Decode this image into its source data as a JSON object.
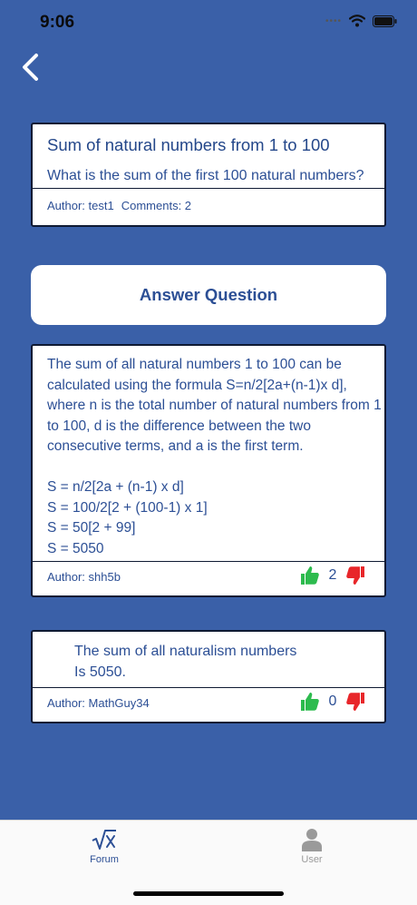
{
  "status_bar": {
    "time": "9:06"
  },
  "question": {
    "title": "Sum of natural numbers from 1 to 100",
    "body": "What is the sum of the first 100 natural numbers?",
    "author": "Author: test1",
    "comments": "Comments: 2"
  },
  "answer_button": {
    "label": "Answer Question"
  },
  "answers": [
    {
      "text": "The sum of all natural numbers 1 to 100 can be calculated using the formula S=n/2[2a+(n-1)x d], where n is the total number of natural numbers from 1 to 100, d is the difference between the two consecutive terms, and a is the first term.\n\nS = n/2[2a + (n-1) x d]\nS = 100/2[2 + (100-1) x 1]\nS = 50[2 + 99]\nS = 5050",
      "author": "Author: shh5b",
      "votes": "2"
    },
    {
      "text": "The sum of all naturalism numbers\nIs 5050.",
      "author": "Author: MathGuy34",
      "votes": "0"
    }
  ],
  "tab_bar": {
    "forum_label": "Forum",
    "user_label": "User"
  },
  "colors": {
    "background": "#3a60a8",
    "text_blue": "#2c4f95",
    "upvote_green": "#2dbb4e",
    "downvote_red": "#e8262a",
    "tab_active": "#2c4f95",
    "tab_inactive": "#9a9a9a"
  },
  "icons": [
    "back-chevron-icon",
    "wifi-icon",
    "battery-icon",
    "thumbs-up-icon",
    "thumbs-down-icon",
    "square-root-icon",
    "user-icon"
  ]
}
